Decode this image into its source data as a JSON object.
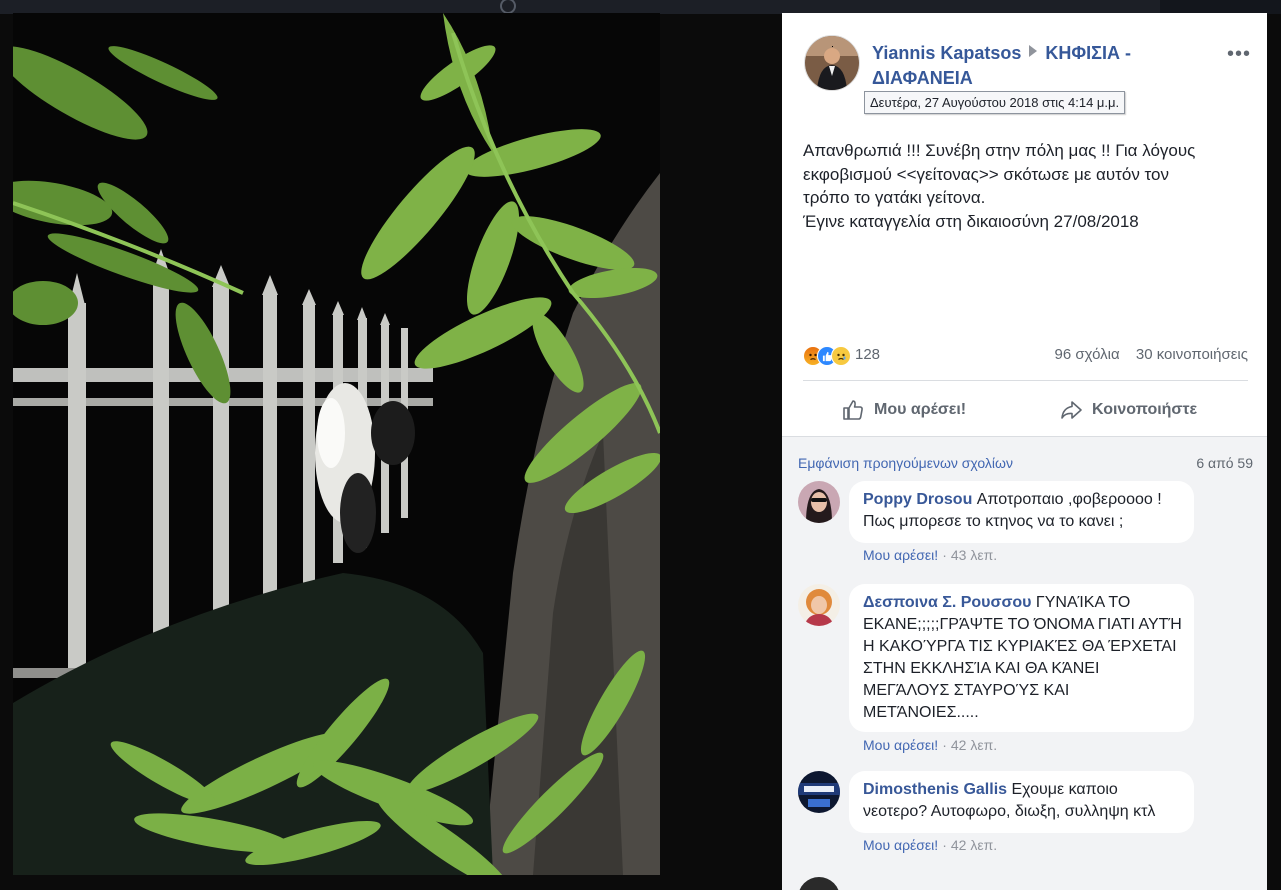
{
  "post": {
    "author": "Yiannis Kapatsos",
    "group_line1": "ΚΗΦΙΣΙΑ -",
    "group_line2": "ΔΙΑΦΑΝΕΙΑ",
    "timestamp_tooltip": "Δευτέρα, 27 Αυγούστου 2018 στις 4:14 μ.μ.",
    "text_lines": [
      "Απανθρωπιά !!! Συνέβη στην πόλη μας !! Για λόγους",
      "εκφοβισμού <<γείτονας>> σκότωσε με αυτόν τον",
      "τρόπο το γατάκι γείτονα.",
      "Έγινε καταγγελία στη δικαιοσύνη 27/08/2018"
    ],
    "more_label": "•••"
  },
  "stats": {
    "reactions_count": "128",
    "comments": "96 σχόλια",
    "shares": "30 κοινοποιήσεις",
    "reaction_icons": [
      "angry-reaction-icon",
      "like-reaction-icon",
      "sad-reaction-icon"
    ]
  },
  "actions": {
    "like_label": "Μου αρέσει!",
    "share_label": "Κοινοποιήστε"
  },
  "comments": {
    "previous_link": "Εμφάνιση προηγούμενων σχολίων",
    "count": "6 από 59",
    "items": [
      {
        "name": "Poppy Drosou",
        "text": "Αποτροπαιο ,φοβεροοοο ! Πως μπορεσε το κτηνος να το κανει ;",
        "like": "Μου αρέσει!",
        "time": "43 λεπ."
      },
      {
        "name": "Δεσποινα Σ. Ρουσσου",
        "text": "ΓΥΝΑΊΚΑ ΤΟ ΕΚΑΝΕ;;;;;ΓΡΆΨΤΕ ΤΟ ΌΝΟΜΑ ΓΙΑΤΙ ΑΥΤΉ Η ΚΑΚΟΎΡΓΑ ΤΙΣ ΚΥΡΙΑΚΈΣ ΘΑ ΈΡΧΕΤΑΙ ΣΤΗΝ ΕΚΚΛΗΣΊΑ ΚΑΙ ΘΑ ΚΆΝΕΙ ΜΕΓΆΛΟΥΣ ΣΤΑΥΡΟΎΣ ΚΑΙ ΜΕΤΆΝΟΙΕΣ.....",
        "like": "Μου αρέσει!",
        "time": "42 λεπ."
      },
      {
        "name": "Dimosthenis Gallis",
        "text": "Εχουμε καποιο νεοτερο? Αυτοφωρο, διωξη, συλληψη κτλ",
        "like": "Μου αρέσει!",
        "time": "42 λεπ."
      }
    ]
  },
  "colors": {
    "link": "#365899",
    "accent": "#4267b2",
    "muted": "#606770",
    "comment_bg": "#f2f3f5",
    "theater_bg": "#0b0b0b"
  }
}
